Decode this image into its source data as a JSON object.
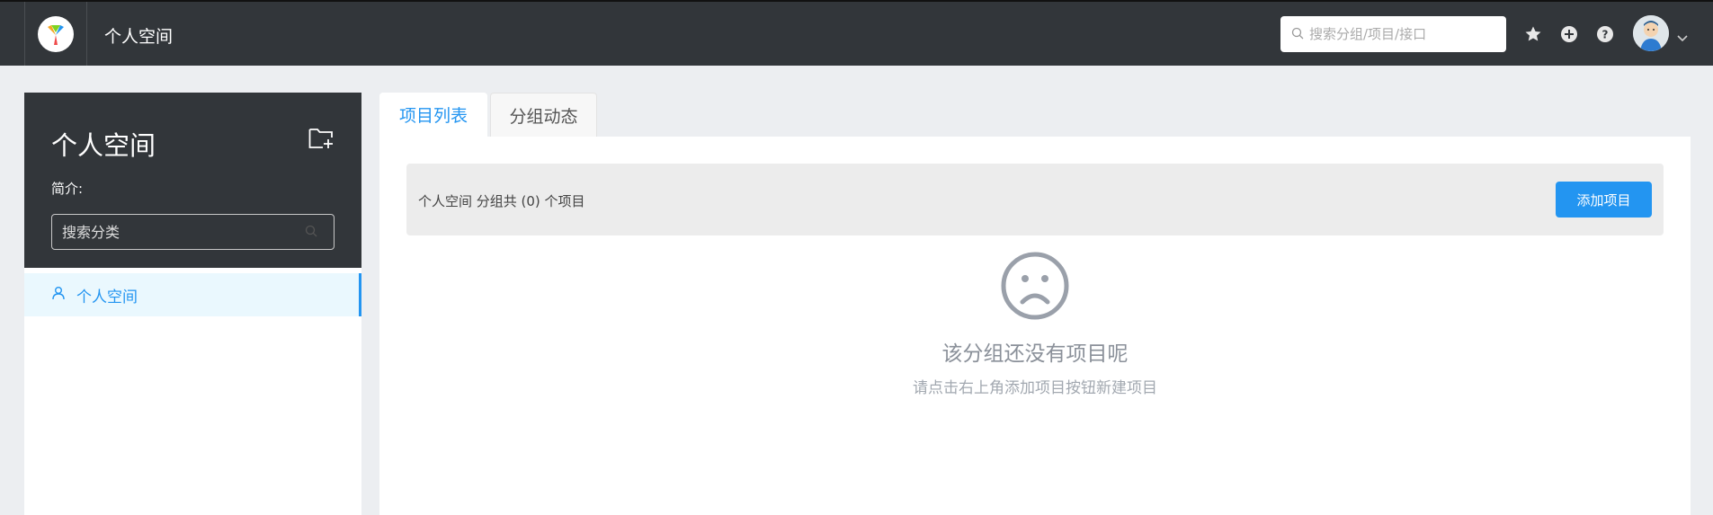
{
  "header": {
    "title": "个人空间",
    "search_placeholder": "搜索分组/项目/接口",
    "icons": [
      "star-icon",
      "plus-circle-icon",
      "help-icon",
      "avatar",
      "chevron-down-icon"
    ]
  },
  "sidebar": {
    "group_title": "个人空间",
    "intro_label": "简介:",
    "search_placeholder": "搜索分类",
    "items": [
      {
        "label": "个人空间",
        "icon": "user-icon",
        "selected": true
      }
    ]
  },
  "tabs": [
    {
      "label": "项目列表",
      "active": true
    },
    {
      "label": "分组动态",
      "active": false
    }
  ],
  "main": {
    "summary": "个人空间 分组共 (0) 个项目",
    "add_button": "添加项目",
    "empty_title": "该分组还没有项目呢",
    "empty_subtitle": "请点击右上角添加项目按钮新建项目"
  },
  "colors": {
    "header_bg": "#32363a",
    "accent": "#2395f1",
    "page_bg": "#eceef1"
  }
}
